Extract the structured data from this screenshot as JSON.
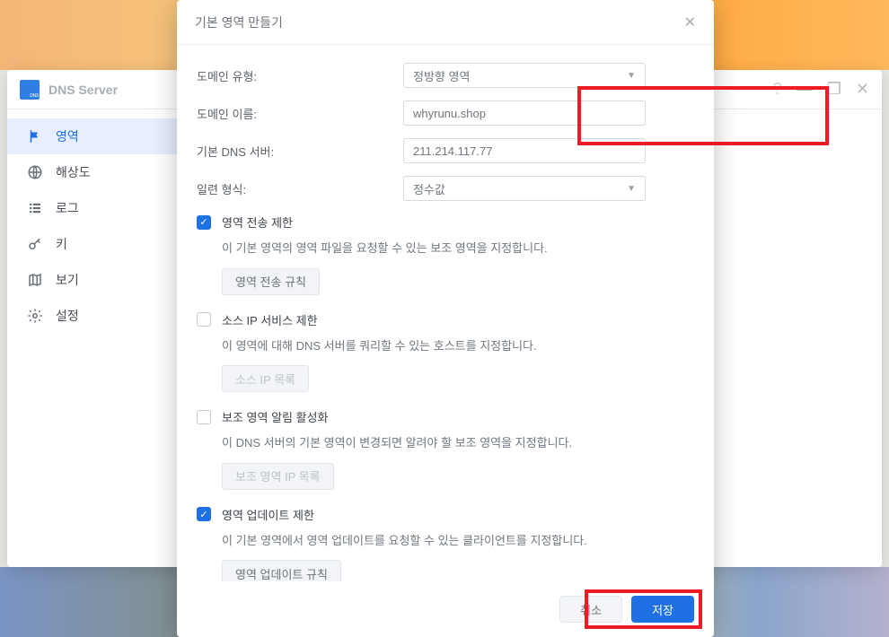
{
  "app": {
    "title": "DNS Server",
    "window_controls": {
      "help": "?",
      "minimize": "—",
      "maximize": "❐",
      "close": "✕"
    }
  },
  "sidebar": {
    "items": [
      {
        "icon": "flag-icon",
        "label": "영역"
      },
      {
        "icon": "globe-icon",
        "label": "해상도"
      },
      {
        "icon": "list-icon",
        "label": "로그"
      },
      {
        "icon": "key-icon",
        "label": "키"
      },
      {
        "icon": "map-icon",
        "label": "보기"
      },
      {
        "icon": "gear-icon",
        "label": "설정"
      }
    ]
  },
  "modal": {
    "title": "기본 영역 만들기",
    "fields": {
      "domain_type_label": "도메인 유형:",
      "domain_type_value": "정방향 영역",
      "domain_name_label": "도메인 이름:",
      "domain_name_value": "whyrunu.shop",
      "dns_server_label": "기본 DNS 서버:",
      "dns_server_value": "211.214.117.77",
      "serial_format_label": "일련 형식:",
      "serial_format_value": "정수값"
    },
    "sections": [
      {
        "chk": true,
        "title": "영역 전송 제한",
        "desc": "이 기본 영역의 영역 파일을 요청할 수 있는 보조 영역을 지정합니다.",
        "btn": "영역 전송 규칙",
        "btn_disabled": false
      },
      {
        "chk": false,
        "title": "소스 IP 서비스 제한",
        "desc": "이 영역에 대해 DNS 서버를 쿼리할 수 있는 호스트를 지정합니다.",
        "btn": "소스 IP 목록",
        "btn_disabled": true
      },
      {
        "chk": false,
        "title": "보조 영역 알림 활성화",
        "desc": "이 DNS 서버의 기본 영역이 변경되면 알려야 할 보조 영역을 지정합니다.",
        "btn": "보조 영역 IP 목록",
        "btn_disabled": true
      },
      {
        "chk": true,
        "title": "영역 업데이트 제한",
        "desc": "이 기본 영역에서 영역 업데이트를 요청할 수 있는 클라이언트를 지정합니다.",
        "btn": "영역 업데이트 규칙",
        "btn_disabled": false
      }
    ],
    "buttons": {
      "cancel": "취소",
      "save": "저장"
    }
  }
}
